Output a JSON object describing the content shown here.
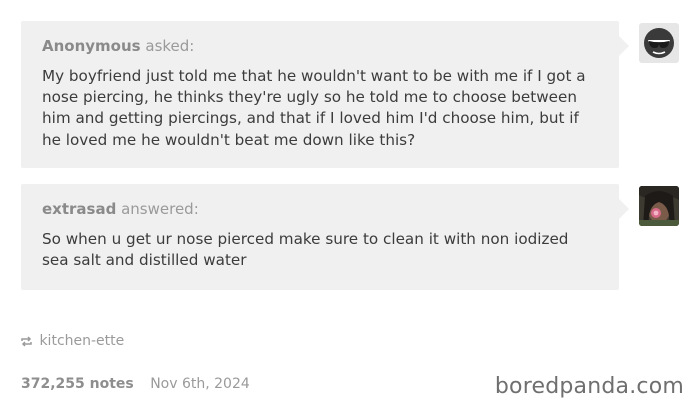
{
  "question": {
    "asker": "Anonymous",
    "verb": "asked:",
    "text": "My boyfriend just told me that he wouldn't want to be with me if I got a nose piercing, he thinks they're ugly so he told me to choose between him and getting piercings, and that if I loved him I'd choose him, but if he loved me he wouldn't beat me down like this?"
  },
  "answer": {
    "answerer": "extrasad",
    "verb": "answered:",
    "text": "So when u get ur nose pierced make sure to clean it with non iodized sea salt and distilled water"
  },
  "reblog": {
    "icon": "reblog-icon",
    "blog": "kitchen-ette"
  },
  "footer": {
    "notes": "372,255 notes",
    "date": "Nov 6th, 2024"
  },
  "watermark": "boredpanda.com",
  "colors": {
    "bubble": "#f0f0f0",
    "muted_text": "#9a9a9a",
    "body_text": "#3c3c3c"
  }
}
